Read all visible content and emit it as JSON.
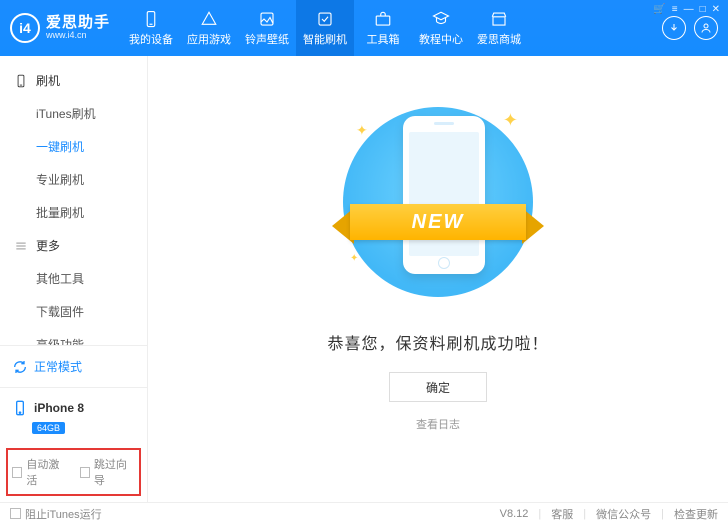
{
  "brand": {
    "logo_text": "i4",
    "title": "爱思助手",
    "subtitle": "www.i4.cn"
  },
  "tabs": [
    {
      "label": "我的设备"
    },
    {
      "label": "应用游戏"
    },
    {
      "label": "铃声壁纸"
    },
    {
      "label": "智能刷机"
    },
    {
      "label": "工具箱"
    },
    {
      "label": "教程中心"
    },
    {
      "label": "爱思商城"
    }
  ],
  "sidebar": {
    "group1": {
      "title": "刷机",
      "items": [
        "iTunes刷机",
        "一键刷机",
        "专业刷机",
        "批量刷机"
      ]
    },
    "group2": {
      "title": "更多",
      "items": [
        "其他工具",
        "下载固件",
        "高级功能"
      ]
    }
  },
  "device": {
    "mode": "正常模式",
    "name": "iPhone 8",
    "storage": "64GB"
  },
  "checks": {
    "auto_activate": "自动激活",
    "skip_guide": "跳过向导"
  },
  "main": {
    "ribbon": "NEW",
    "message": "恭喜您，保资料刷机成功啦！",
    "ok": "确定",
    "view_log": "查看日志"
  },
  "footer": {
    "block_itunes": "阻止iTunes运行",
    "version": "V8.12",
    "support": "客服",
    "wechat": "微信公众号",
    "update": "检查更新"
  }
}
